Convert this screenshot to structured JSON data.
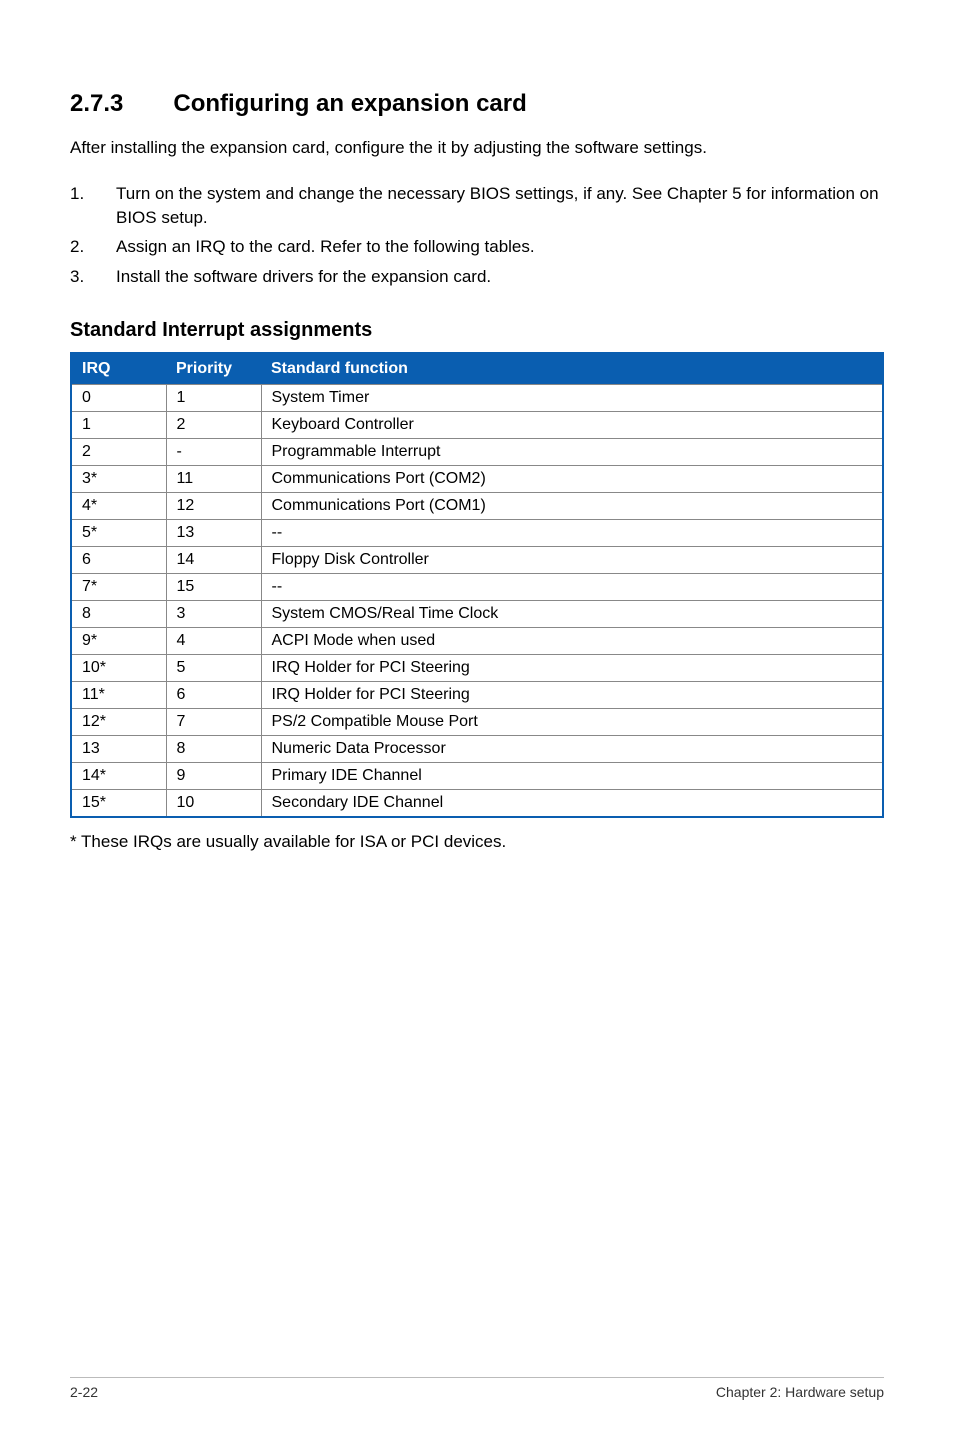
{
  "section": {
    "number": "2.7.3",
    "title": "Configuring an expansion card"
  },
  "intro": "After installing the expansion card, configure the it by adjusting the software settings.",
  "steps": [
    {
      "num": "1.",
      "text": "Turn on the system and change the necessary BIOS settings, if any. See Chapter 5 for information on BIOS setup."
    },
    {
      "num": "2.",
      "text": "Assign an IRQ to the card. Refer to the following tables."
    },
    {
      "num": "3.",
      "text": "Install the software drivers for the expansion card."
    }
  ],
  "subheading": "Standard Interrupt assignments",
  "table": {
    "headers": {
      "irq": "IRQ",
      "priority": "Priority",
      "func": "Standard function"
    },
    "rows": [
      {
        "irq": "0",
        "priority": "1",
        "func": "System Timer"
      },
      {
        "irq": "1",
        "priority": "2",
        "func": "Keyboard Controller"
      },
      {
        "irq": "2",
        "priority": "-",
        "func": "Programmable Interrupt"
      },
      {
        "irq": "3*",
        "priority": "11",
        "func": "Communications Port (COM2)"
      },
      {
        "irq": "4*",
        "priority": "12",
        "func": "Communications Port (COM1)"
      },
      {
        "irq": "5*",
        "priority": "13",
        "func": "--"
      },
      {
        "irq": "6",
        "priority": "14",
        "func": "Floppy Disk Controller"
      },
      {
        "irq": "7*",
        "priority": "15",
        "func": "--"
      },
      {
        "irq": "8",
        "priority": "3",
        "func": "System CMOS/Real Time Clock"
      },
      {
        "irq": "9*",
        "priority": "4",
        "func": "ACPI Mode when used"
      },
      {
        "irq": "10*",
        "priority": "5",
        "func": "IRQ Holder for PCI Steering"
      },
      {
        "irq": "11*",
        "priority": "6",
        "func": "IRQ Holder for PCI Steering"
      },
      {
        "irq": "12*",
        "priority": "7",
        "func": "PS/2 Compatible Mouse Port"
      },
      {
        "irq": "13",
        "priority": "8",
        "func": "Numeric Data Processor"
      },
      {
        "irq": "14*",
        "priority": "9",
        "func": "Primary IDE Channel"
      },
      {
        "irq": "15*",
        "priority": "10",
        "func": "Secondary IDE Channel"
      }
    ]
  },
  "footnote": "* These IRQs are usually available for ISA or PCI devices.",
  "footer": {
    "left": "2-22",
    "right": "Chapter 2:  Hardware setup"
  }
}
